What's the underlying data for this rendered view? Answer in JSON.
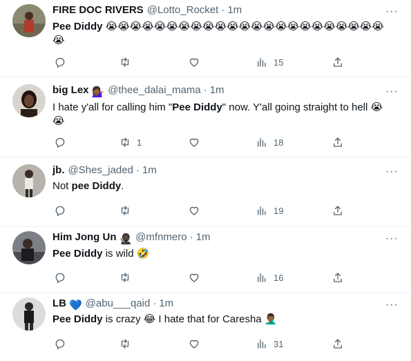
{
  "tweets": [
    {
      "name": "FIRE DOC RIVERS",
      "name_badge": "",
      "handle": "@Lotto_Rocket",
      "time": "1m",
      "text_parts": [
        "Pee Diddy",
        " 😭😭😭😭😭😭😭😭😭😭😭😭😭😭😭😭😭😭😭😭😭😭😭😭"
      ],
      "replies": "",
      "retweets": "",
      "views": "15"
    },
    {
      "name": "big Lex",
      "name_badge": "💁🏾‍♀️",
      "handle": "@thee_dalai_mama",
      "time": "1m",
      "text_parts": [
        "I hate y'all for calling him \"",
        "Pee Diddy",
        "\" now. Y'all going straight to hell 😭😭"
      ],
      "replies": "",
      "retweets": "1",
      "views": "18"
    },
    {
      "name": "jb.",
      "name_badge": "",
      "handle": "@Shes_jaded",
      "time": "1m",
      "text_parts": [
        "Not ",
        "pee Diddy",
        "."
      ],
      "replies": "",
      "retweets": "",
      "views": "19"
    },
    {
      "name": "Him Jong Un",
      "name_badge": "🥷🏿",
      "handle": "@mfnmero",
      "time": "1m",
      "text_parts": [
        "Pee Diddy",
        " is wild 🤣"
      ],
      "replies": "",
      "retweets": "",
      "views": "16"
    },
    {
      "name": "LB",
      "name_badge": "💙",
      "handle": "@abu___qaid",
      "time": "1m",
      "text_parts": [
        "Pee Diddy",
        " is crazy 😂 I hate that for Caresha 🤦🏾‍♂️"
      ],
      "replies": "",
      "retweets": "",
      "views": "31"
    }
  ],
  "icons": {
    "reply": "reply-icon",
    "retweet": "retweet-icon",
    "like": "like-icon",
    "views": "views-icon",
    "share": "share-icon",
    "more": "more-icon"
  },
  "colors": {
    "text": "#0f1419",
    "secondary": "#536471",
    "divider": "#eff3f4"
  }
}
